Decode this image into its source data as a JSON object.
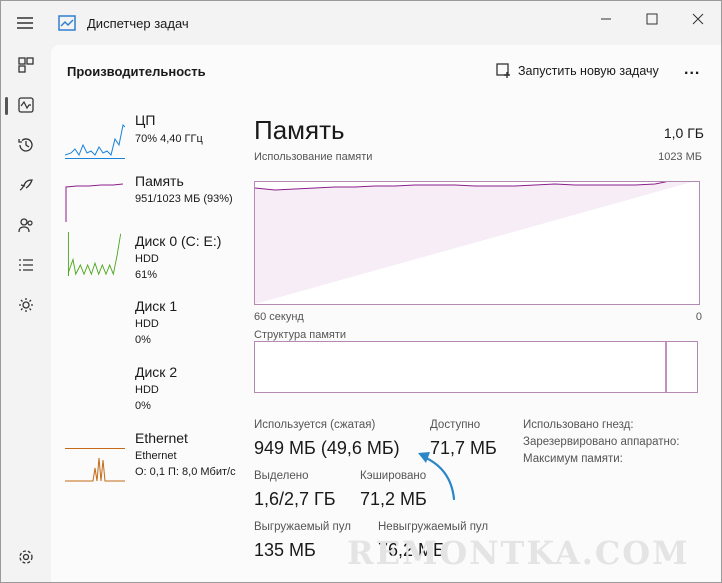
{
  "app": {
    "title": "Диспетчер задач"
  },
  "section_title": "Производительность",
  "toolbar": {
    "run_task_label": "Запустить новую задачу",
    "more_label": "..."
  },
  "sidebar": [
    {
      "name": "ЦП",
      "line1": "70% 4,40 ГГц",
      "line2": "",
      "color": "#1a82d9"
    },
    {
      "name": "Память",
      "line1": "951/1023 МБ (93%)",
      "line2": "",
      "color": "#8b1f8b"
    },
    {
      "name": "Диск 0 (C: E:)",
      "line1": "HDD",
      "line2": "61%",
      "color": "#4ca61b"
    },
    {
      "name": "Диск 1",
      "line1": "HDD",
      "line2": "0%",
      "color": "#4ca61b"
    },
    {
      "name": "Диск 2",
      "line1": "HDD",
      "line2": "0%",
      "color": "#4ca61b"
    },
    {
      "name": "Ethernet",
      "line1": "Ethernet",
      "line2": "О: 0,1 П: 8,0 Мбит/с",
      "color": "#c46a16"
    }
  ],
  "detail": {
    "title": "Память",
    "total": "1,0 ГБ",
    "usage_label": "Использование памяти",
    "max_label": "1023 МБ",
    "time_label": "60 секунд",
    "zero_label": "0",
    "structure_label": "Структура памяти",
    "accent": "#8b1f8b"
  },
  "stats": {
    "in_use_label": "Используется (сжатая)",
    "in_use_value": "949 МБ (49,6 МБ)",
    "available_label": "Доступно",
    "available_value": "71,7 МБ",
    "slots_label": "Использовано гнезд:",
    "reserved_label": "Зарезервировано аппаратно:",
    "max_memory_label": "Максимум памяти:",
    "committed_label": "Выделено",
    "committed_value": "1,6/2,7 ГБ",
    "cached_label": "Кэшировано",
    "cached_value": "71,2 МБ",
    "paged_label": "Выгружаемый пул",
    "paged_value": "135 МБ",
    "nonpaged_label": "Невыгружаемый пул",
    "nonpaged_value": "76,2 МБ"
  },
  "watermark": "REMONTKA.COM"
}
